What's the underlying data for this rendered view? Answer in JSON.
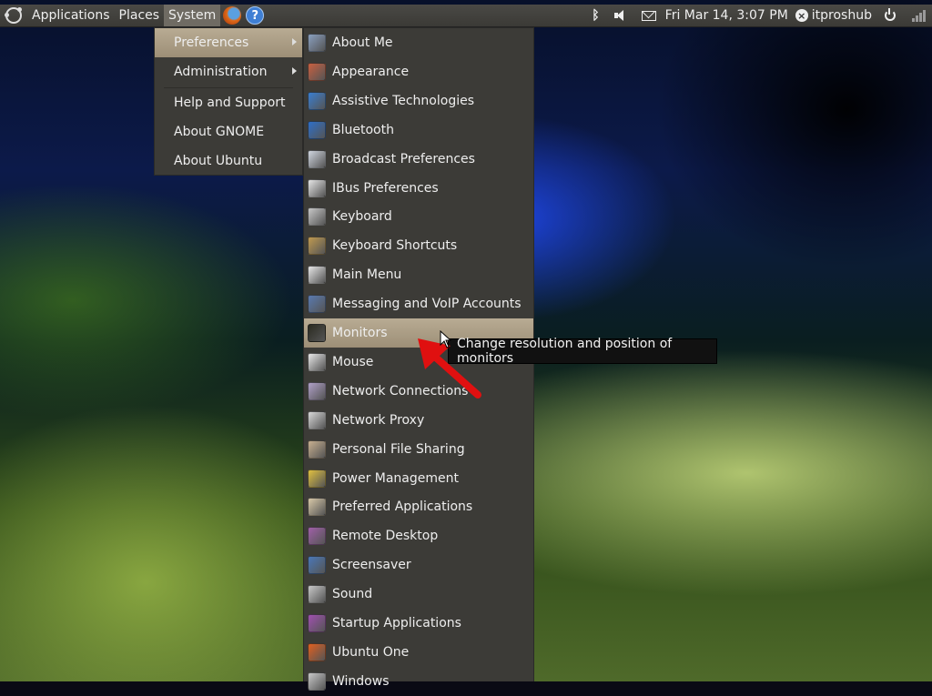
{
  "panel": {
    "menus": [
      "Applications",
      "Places",
      "System"
    ],
    "clock": "Fri Mar 14,  3:07 PM",
    "user": "itproshub"
  },
  "system_menu": {
    "items": [
      {
        "label": "Preferences",
        "submenu": true,
        "highlighted": true
      },
      {
        "label": "Administration",
        "submenu": true
      },
      {
        "label": "Help and Support"
      },
      {
        "label": "About GNOME"
      },
      {
        "label": "About Ubuntu"
      }
    ]
  },
  "preferences_menu": {
    "items": [
      {
        "label": "About Me",
        "icon": "user-icon",
        "color": "#8aa0c0"
      },
      {
        "label": "Appearance",
        "icon": "appearance-icon",
        "color": "#c86040"
      },
      {
        "label": "Assistive Technologies",
        "icon": "accessibility-icon",
        "color": "#3a7ed0"
      },
      {
        "label": "Bluetooth",
        "icon": "bluetooth-icon",
        "color": "#2e6fc8"
      },
      {
        "label": "Broadcast Preferences",
        "icon": "broadcast-icon",
        "color": "#d0d6e0"
      },
      {
        "label": "IBus Preferences",
        "icon": "info-icon",
        "color": "#e6e6e6"
      },
      {
        "label": "Keyboard",
        "icon": "keyboard-icon",
        "color": "#c8c8c8"
      },
      {
        "label": "Keyboard Shortcuts",
        "icon": "keyboard-shortcuts-icon",
        "color": "#c09a50"
      },
      {
        "label": "Main Menu",
        "icon": "main-menu-icon",
        "color": "#e6e6e6"
      },
      {
        "label": "Messaging and VoIP Accounts",
        "icon": "messaging-icon",
        "color": "#5a7ab0"
      },
      {
        "label": "Monitors",
        "icon": "monitor-icon",
        "color": "#2a2a20",
        "highlighted": true
      },
      {
        "label": "Mouse",
        "icon": "mouse-icon",
        "color": "#e8e8e8"
      },
      {
        "label": "Network Connections",
        "icon": "network-icon",
        "color": "#b0a0c8"
      },
      {
        "label": "Network Proxy",
        "icon": "proxy-icon",
        "color": "#d8d8d8"
      },
      {
        "label": "Personal File Sharing",
        "icon": "file-sharing-icon",
        "color": "#c8b090"
      },
      {
        "label": "Power Management",
        "icon": "power-management-icon",
        "color": "#e0c040"
      },
      {
        "label": "Preferred Applications",
        "icon": "preferred-apps-icon",
        "color": "#d8c8a8"
      },
      {
        "label": "Remote Desktop",
        "icon": "remote-desktop-icon",
        "color": "#a060a8"
      },
      {
        "label": "Screensaver",
        "icon": "screensaver-icon",
        "color": "#4a78b8"
      },
      {
        "label": "Sound",
        "icon": "sound-icon",
        "color": "#c8c8c8"
      },
      {
        "label": "Startup Applications",
        "icon": "startup-icon",
        "color": "#a050b0"
      },
      {
        "label": "Ubuntu One",
        "icon": "ubuntu-one-icon",
        "color": "#e06020"
      },
      {
        "label": "Windows",
        "icon": "windows-icon",
        "color": "#c8c8c8"
      }
    ]
  },
  "tooltip": "Change resolution and position of monitors"
}
